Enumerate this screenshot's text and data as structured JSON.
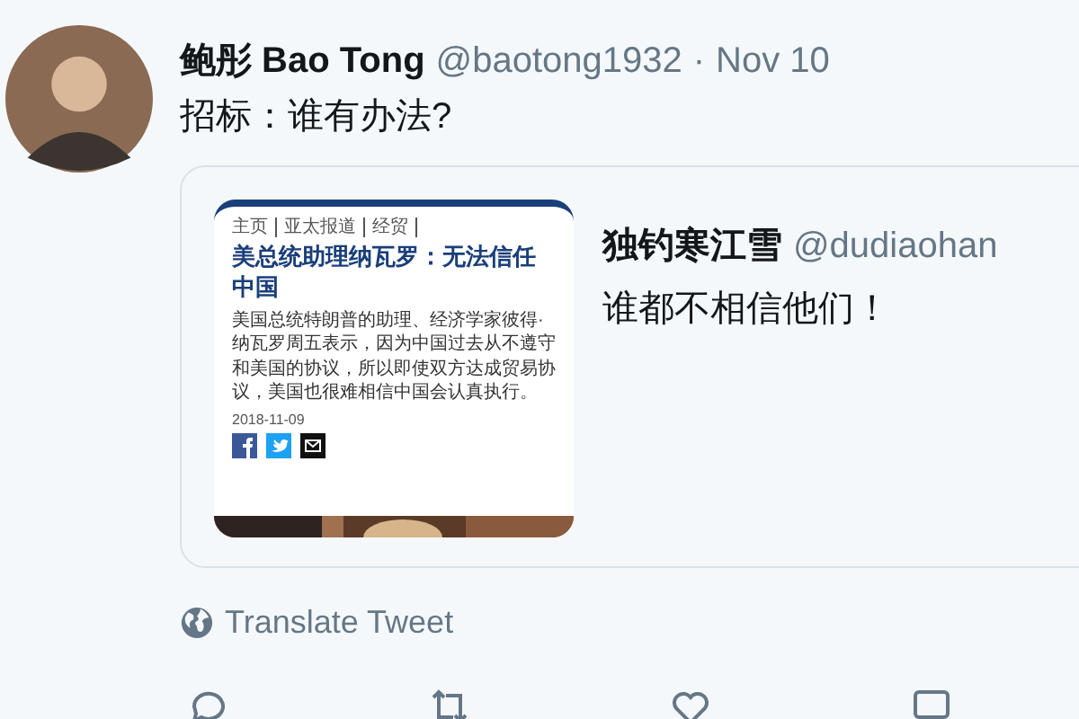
{
  "tweet": {
    "name": "鲍彤 Bao Tong",
    "handle": "@baotong1932",
    "separator": "·",
    "date": "Nov 10",
    "text": "招标：谁有办法?"
  },
  "quote": {
    "article": {
      "nav": [
        "主页",
        "亚太报道",
        "经贸"
      ],
      "title": "美总统助理纳瓦罗：无法信任中国",
      "body": "美国总统特朗普的助理、经济学家彼得·纳瓦罗周五表示，因为中国过去从不遵守和美国的协议，所以即使双方达成贸易协议，美国也很难相信中国会认真执行。",
      "date": "2018-11-09"
    },
    "name": "独钓寒江雪",
    "handle": "@dudiaohan",
    "text": "谁都不相信他们！"
  },
  "translate": "Translate Tweet"
}
